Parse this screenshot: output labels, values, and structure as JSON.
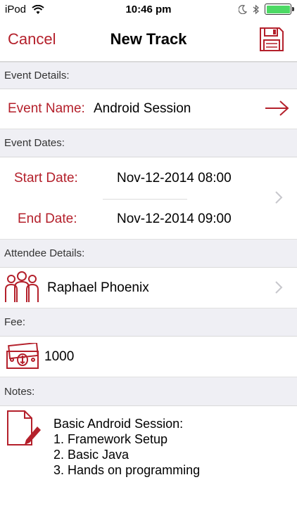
{
  "status_bar": {
    "carrier": "iPod",
    "time": "10:46 pm",
    "battery_level": 1.0,
    "battery_color": "#4cd964"
  },
  "nav": {
    "cancel_label": "Cancel",
    "title": "New Track",
    "save_icon": "save-icon"
  },
  "sections": {
    "event_details": "Event Details:",
    "event_dates": "Event Dates:",
    "attendee_details": "Attendee Details:",
    "fee": "Fee:",
    "notes": "Notes:"
  },
  "event": {
    "name_label": "Event Name:",
    "name_value": "Android Session"
  },
  "dates": {
    "start_label": "Start Date:",
    "start_value": "Nov-12-2014 08:00",
    "end_label": "End Date:",
    "end_value": "Nov-12-2014 09:00"
  },
  "attendee": {
    "name": "Raphael Phoenix"
  },
  "fee": {
    "value": "1000"
  },
  "notes": {
    "lines": [
      "Basic Android Session:",
      "1. Framework Setup",
      "2. Basic Java",
      "3. Hands on programming"
    ]
  },
  "colors": {
    "accent": "#b4202b",
    "section_bg": "#efeff4",
    "chevron": "#c7c7cc"
  }
}
